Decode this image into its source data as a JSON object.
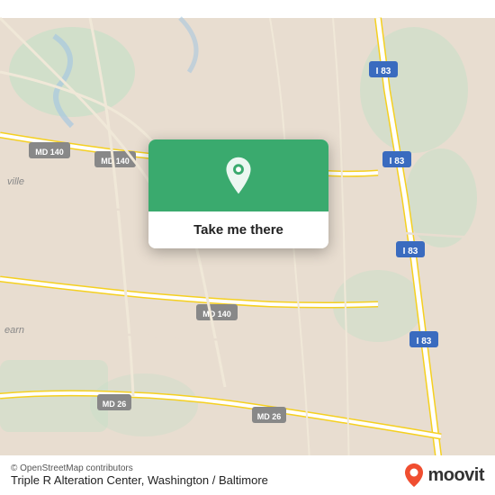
{
  "map": {
    "bg_color": "#e8ddd0",
    "road_color_highway": "#f5c842",
    "road_color_major": "#ffffff",
    "road_color_minor": "#e0d6c8",
    "label_i83": "I 83",
    "label_md140": "MD 140",
    "label_md26": "MD 26"
  },
  "cta": {
    "green_color": "#3aaa6e",
    "button_label": "Take me there",
    "pin_icon": "location-pin"
  },
  "bottom_bar": {
    "attribution": "© OpenStreetMap contributors",
    "location_name": "Triple R Alteration Center, Washington / Baltimore",
    "moovit_label": "moovit"
  }
}
